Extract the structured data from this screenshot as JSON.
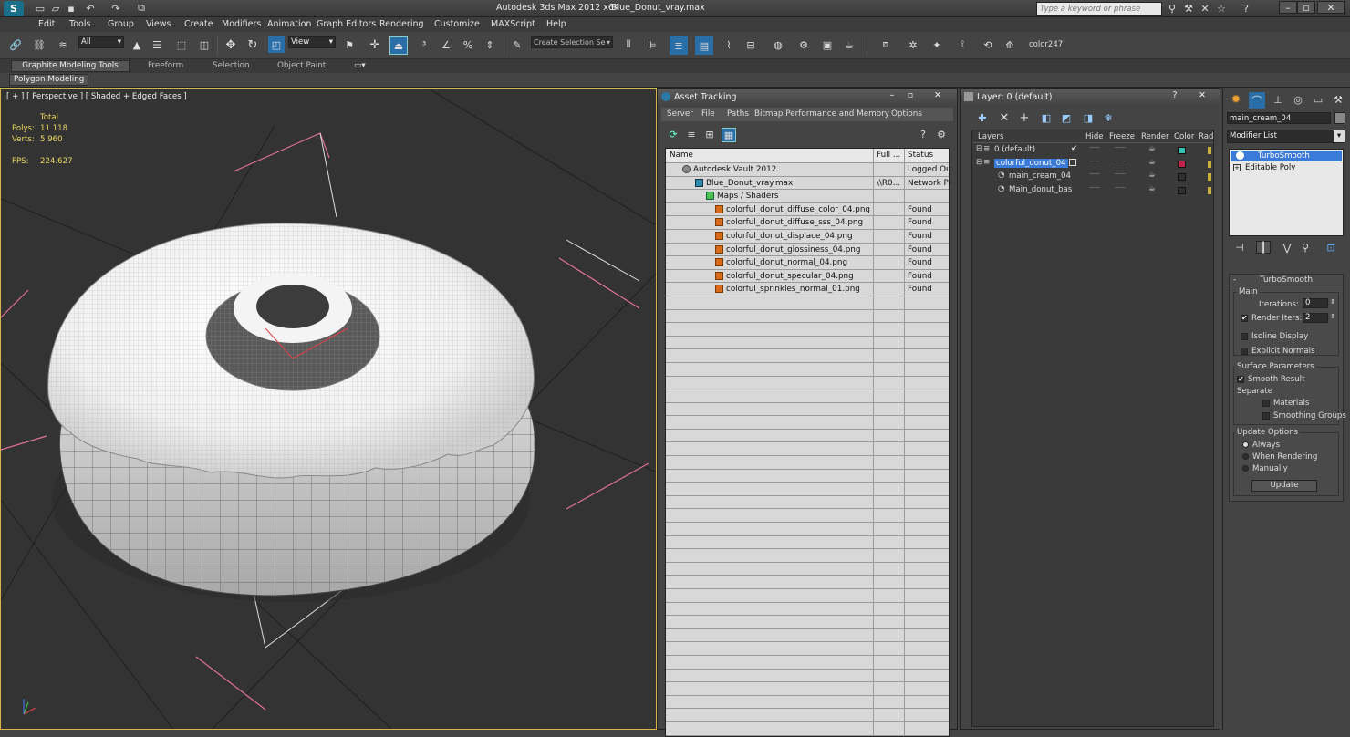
{
  "app": {
    "title": "Autodesk 3ds Max  2012 x64",
    "file": "Blue_Donut_vray.max",
    "search_placeholder": "Type a keyword or phrase"
  },
  "menus": [
    "Edit",
    "Tools",
    "Group",
    "Views",
    "Create",
    "Modifiers",
    "Animation",
    "Graph Editors",
    "Rendering",
    "Customize",
    "MAXScript",
    "Help"
  ],
  "toolbar": {
    "selection_filter": "All",
    "ref_coord": "View",
    "named_selection": "Create Selection Se",
    "color_label": "color247"
  },
  "ribbon": {
    "tabs": [
      "Graphite Modeling Tools",
      "Freeform",
      "Selection",
      "Object Paint"
    ],
    "sub": "Polygon Modeling"
  },
  "viewport": {
    "label": "[ + ] [ Perspective ] [ Shaded + Edged Faces ]",
    "stats": {
      "total": "Total",
      "polys_label": "Polys:",
      "polys": "11 118",
      "verts_label": "Verts:",
      "verts": "5 960",
      "fps_label": "FPS:",
      "fps": "224.627"
    }
  },
  "asset_tracking": {
    "title": "Asset Tracking",
    "menu": [
      "Server",
      "File",
      "Paths",
      "Bitmap Performance and Memory",
      "Options"
    ],
    "columns": [
      "Name",
      "Full ...",
      "Status"
    ],
    "rows": [
      {
        "name": "Autodesk Vault 2012",
        "full": "",
        "status": "Logged Ou",
        "level": 1,
        "kind": "vault"
      },
      {
        "name": "Blue_Donut_vray.max",
        "full": "\\\\R0...",
        "status": "Network Pa",
        "level": 2,
        "kind": "max"
      },
      {
        "name": "Maps / Shaders",
        "full": "",
        "status": "",
        "level": 3,
        "kind": "folder"
      },
      {
        "name": "colorful_donut_diffuse_color_04.png",
        "full": "",
        "status": "Found",
        "level": 4,
        "kind": "file"
      },
      {
        "name": "colorful_donut_diffuse_sss_04.png",
        "full": "",
        "status": "Found",
        "level": 4,
        "kind": "file"
      },
      {
        "name": "colorful_donut_displace_04.png",
        "full": "",
        "status": "Found",
        "level": 4,
        "kind": "file"
      },
      {
        "name": "colorful_donut_glossiness_04.png",
        "full": "",
        "status": "Found",
        "level": 4,
        "kind": "file"
      },
      {
        "name": "colorful_donut_normal_04.png",
        "full": "",
        "status": "Found",
        "level": 4,
        "kind": "file"
      },
      {
        "name": "colorful_donut_specular_04.png",
        "full": "",
        "status": "Found",
        "level": 4,
        "kind": "file"
      },
      {
        "name": "colorful_sprinkles_normal_01.png",
        "full": "",
        "status": "Found",
        "level": 4,
        "kind": "file"
      }
    ]
  },
  "layer_manager": {
    "title": "Layer: 0 (default)",
    "columns": [
      "Layers",
      "Hide",
      "Freeze",
      "Render",
      "Color",
      "Rad"
    ],
    "rows": [
      {
        "name": "0 (default)",
        "level": 0,
        "selected": false,
        "color": "#35c0b0"
      },
      {
        "name": "colorful_donut_04",
        "level": 0,
        "selected": true,
        "color": "#c0224a"
      },
      {
        "name": "main_cream_04",
        "level": 1,
        "selected": false,
        "color": "#303030"
      },
      {
        "name": "Main_donut_bas",
        "level": 1,
        "selected": false,
        "color": "#303030"
      }
    ]
  },
  "command_panel": {
    "object_name": "main_cream_04",
    "modifier_list": "Modifier List",
    "stack": [
      "TurboSmooth",
      "Editable Poly"
    ],
    "turbosmooth": {
      "title": "TurboSmooth",
      "main": "Main",
      "iterations_label": "Iterations:",
      "iterations": "0",
      "render_iters_label": "Render Iters:",
      "render_iters": "2",
      "isoline": "Isoline Display",
      "explicit": "Explicit Normals",
      "surface": "Surface Parameters",
      "smooth": "Smooth Result",
      "separate": "Separate",
      "materials": "Materials",
      "smoothing": "Smoothing Groups",
      "update_opts": "Update Options",
      "always": "Always",
      "when_rendering": "When Rendering",
      "manually": "Manually",
      "update_btn": "Update"
    }
  }
}
